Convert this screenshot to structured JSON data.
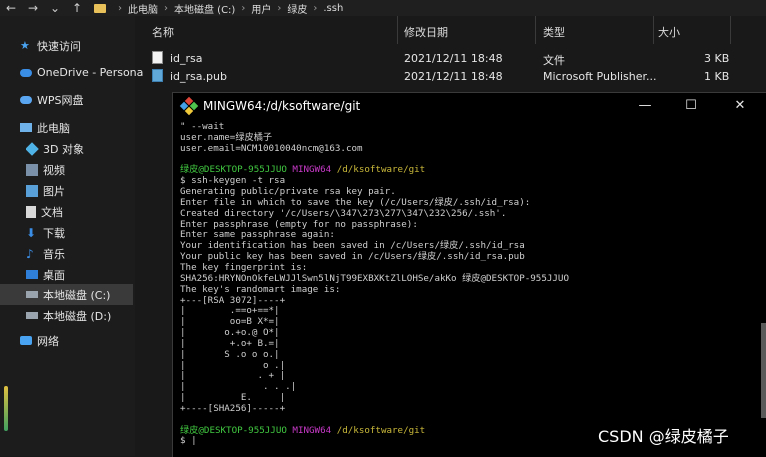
{
  "explorer": {
    "nav": {
      "back": "←",
      "forward": "→",
      "down": "⌄",
      "up": "↑"
    },
    "breadcrumb": [
      "此电脑",
      "本地磁盘 (C:)",
      "用户",
      "绿皮",
      ".ssh"
    ],
    "sidebar": [
      {
        "label": "快速访问",
        "icon": "star-icon"
      },
      {
        "label": "OneDrive - Persona",
        "icon": "cloud-icon"
      },
      {
        "label": "WPS网盘",
        "icon": "cloud-icon"
      },
      {
        "label": "此电脑",
        "icon": "computer-icon"
      },
      {
        "label": "3D 对象",
        "icon": "cube-icon"
      },
      {
        "label": "视频",
        "icon": "video-icon"
      },
      {
        "label": "图片",
        "icon": "picture-icon"
      },
      {
        "label": "文档",
        "icon": "document-icon"
      },
      {
        "label": "下载",
        "icon": "download-icon"
      },
      {
        "label": "音乐",
        "icon": "music-icon"
      },
      {
        "label": "桌面",
        "icon": "desktop-icon"
      },
      {
        "label": "本地磁盘 (C:)",
        "icon": "drive-icon"
      },
      {
        "label": "本地磁盘 (D:)",
        "icon": "drive-icon"
      },
      {
        "label": "网络",
        "icon": "network-icon"
      }
    ],
    "columns": {
      "name": "名称",
      "modified": "修改日期",
      "type": "类型",
      "size": "大小"
    },
    "files": [
      {
        "name": "id_rsa",
        "modified": "2021/12/11 18:48",
        "type": "文件",
        "size": "3 KB"
      },
      {
        "name": "id_rsa.pub",
        "modified": "2021/12/11 18:48",
        "type": "Microsoft Publisher...",
        "size": "1 KB"
      }
    ]
  },
  "terminal": {
    "title": "MINGW64:/d/ksoftware/git",
    "buttons": {
      "minimize": "—",
      "maximize": "☐",
      "close": "✕"
    },
    "lines": [
      "\" --wait",
      "user.name=绿皮橘子",
      "user.email=NCM10010040ncm@163.com",
      "",
      "PROMPT",
      "$ ssh-keygen -t rsa",
      "Generating public/private rsa key pair.",
      "Enter file in which to save the key (/c/Users/绿皮/.ssh/id_rsa):",
      "Created directory '/c/Users/\\347\\273\\277\\347\\232\\256/.ssh'.",
      "Enter passphrase (empty for no passphrase):",
      "Enter same passphrase again:",
      "Your identification has been saved in /c/Users/绿皮/.ssh/id_rsa",
      "Your public key has been saved in /c/Users/绿皮/.ssh/id_rsa.pub",
      "The key fingerprint is:",
      "SHA256:HRYNOnOkfeLWJJlSwn5lNjT99EXBXKtZlLOHSe/akKo 绿皮@DESKTOP-955JJUO",
      "The key's randomart image is:",
      "+---[RSA 3072]----+",
      "|        .==o+==*|",
      "|        oo=B X*=|",
      "|       o.+o.@ O*|",
      "|        +.o+ B.=|",
      "|       S .o o o.|",
      "|              o .|",
      "|             . + |",
      "|              . . .|",
      "|          E.     |",
      "+----[SHA256]-----+",
      "",
      "PROMPT",
      "$ |"
    ],
    "prompt": {
      "user": "绿皮@DESKTOP-955JJUO",
      "env": "MINGW64",
      "path": "/d/ksoftware/git"
    }
  },
  "watermark": "CSDN @绿皮橘子"
}
